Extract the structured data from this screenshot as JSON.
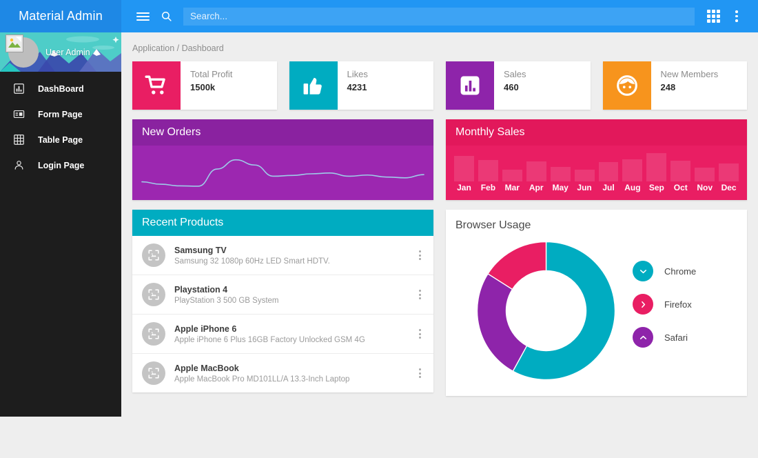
{
  "topbar": {
    "brand": "Material Admin",
    "menu_icon": "hamburger-icon",
    "search_icon": "search-icon",
    "search_placeholder": "Search...",
    "search_value": "",
    "apps_icon": "grid-apps-icon",
    "more_icon": "vertical-dots-icon",
    "bg": "#2196F3",
    "brand_bg": "#1E88E5"
  },
  "sidebar": {
    "profile_name": "User Admin",
    "avatar_icon": "broken-image-avatar",
    "items": [
      {
        "label": "DashBoard",
        "icon": "bar-chart-icon"
      },
      {
        "label": "Form Page",
        "icon": "form-layout-icon"
      },
      {
        "label": "Table Page",
        "icon": "grid-table-icon"
      },
      {
        "label": "Login Page",
        "icon": "person-icon"
      }
    ]
  },
  "breadcrumb": "Application / Dashboard",
  "stats": [
    {
      "title": "Total Profit",
      "value": "1500k",
      "icon": "shopping-cart-icon",
      "color": "#E91E63"
    },
    {
      "title": "Likes",
      "value": "4231",
      "icon": "thumb-up-icon",
      "color": "#00ACC1"
    },
    {
      "title": "Sales",
      "value": "460",
      "icon": "bar-chart-icon",
      "color": "#8E24AA"
    },
    {
      "title": "New Members",
      "value": "248",
      "icon": "face-icon",
      "color": "#F7941D"
    }
  ],
  "panels": {
    "new_orders_title": "New Orders",
    "monthly_sales_title": "Monthly Sales",
    "recent_products_title": "Recent Products",
    "browser_usage_title": "Browser Usage"
  },
  "products": [
    {
      "name": "Samsung TV",
      "desc": "Samsung 32 1080p 60Hz LED Smart HDTV.",
      "thumb": "image-placeholder-icon",
      "menu": "vertical-dots-icon"
    },
    {
      "name": "Playstation 4",
      "desc": "PlayStation 3 500 GB System",
      "thumb": "image-placeholder-icon",
      "menu": "vertical-dots-icon"
    },
    {
      "name": "Apple iPhone 6",
      "desc": "Apple iPhone 6 Plus 16GB Factory Unlocked GSM 4G",
      "thumb": "image-placeholder-icon",
      "menu": "vertical-dots-icon"
    },
    {
      "name": "Apple MacBook",
      "desc": "Apple MacBook Pro MD101LL/A 13.3-Inch Laptop",
      "thumb": "image-placeholder-icon",
      "menu": "vertical-dots-icon"
    }
  ],
  "browser_legend": [
    {
      "label": "Chrome",
      "color": "#00ACC1",
      "icon": "chevron-down-icon"
    },
    {
      "label": "Firefox",
      "color": "#E91E63",
      "icon": "chevron-right-icon"
    },
    {
      "label": "Safari",
      "color": "#8E24AA",
      "icon": "chevron-up-icon"
    }
  ],
  "chart_data": [
    {
      "type": "line",
      "title": "New Orders",
      "x": [
        0,
        1,
        2,
        3,
        4,
        5,
        6,
        7,
        8,
        9,
        10,
        11
      ],
      "values": [
        30,
        24,
        20,
        19,
        62,
        85,
        72,
        44,
        46,
        50,
        52,
        44,
        47,
        42,
        40,
        48
      ],
      "categories": [],
      "xlabel": "",
      "ylabel": "",
      "ylim": [
        0,
        100
      ],
      "grid": false,
      "legend": "none",
      "line_color": "#9ecbe8",
      "background": "#9C27B0"
    },
    {
      "type": "bar",
      "title": "Monthly Sales",
      "categories": [
        "Jan",
        "Feb",
        "Mar",
        "Apr",
        "May",
        "Jun",
        "Jul",
        "Aug",
        "Sep",
        "Oct",
        "Nov",
        "Dec"
      ],
      "values": [
        80,
        68,
        38,
        64,
        46,
        36,
        60,
        70,
        90,
        66,
        44,
        56
      ],
      "xlabel": "",
      "ylabel": "",
      "ylim": [
        0,
        100
      ],
      "grid": false,
      "legend": "none",
      "bar_color": "rgba(255,255,255,0.12)",
      "background": "#E91E63"
    },
    {
      "type": "pie",
      "title": "Browser Usage",
      "categories": [
        "Chrome",
        "Safari",
        "Firefox"
      ],
      "values": [
        58,
        26,
        16
      ],
      "colors": [
        "#00ACC1",
        "#8E24AA",
        "#E91E63"
      ],
      "donut": true,
      "legend": "right",
      "xlabel": "",
      "ylabel": ""
    }
  ]
}
